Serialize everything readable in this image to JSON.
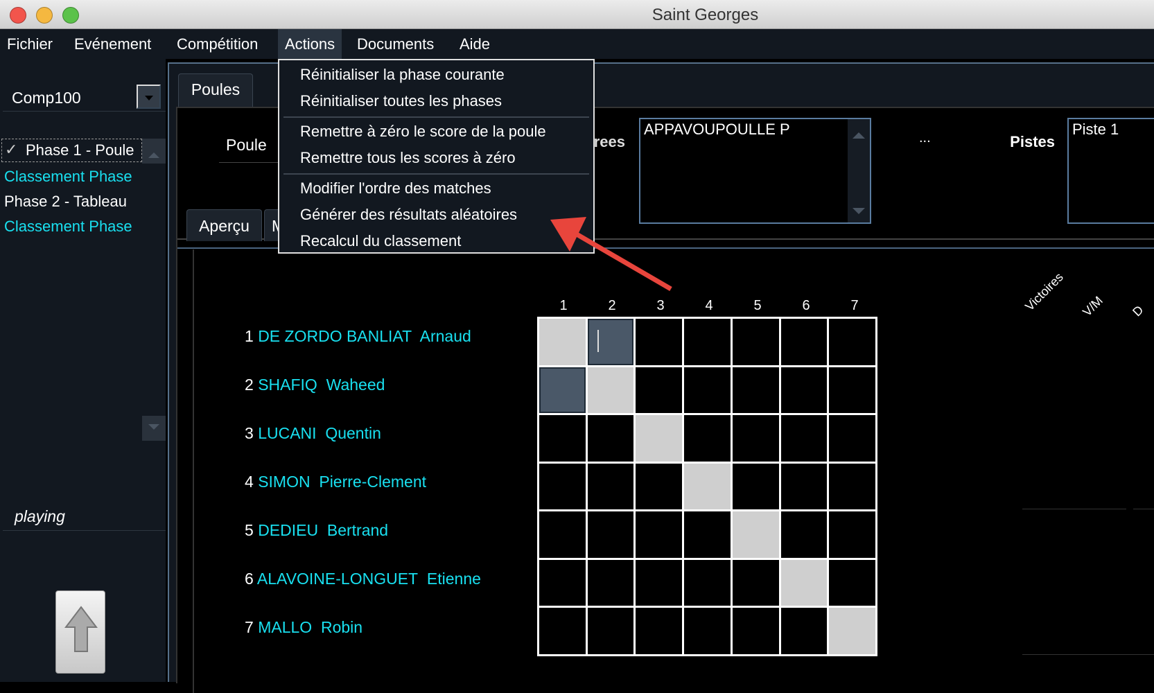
{
  "window": {
    "title": "Saint Georges"
  },
  "menubar": [
    "Fichier",
    "Evénement",
    "Compétition",
    "Actions",
    "Documents",
    "Aide"
  ],
  "sidebar": {
    "competition": "Comp100",
    "phases": [
      {
        "label": "Phase 1 - Poule",
        "checked": true,
        "color": "white"
      },
      {
        "label": "Classement Phase",
        "color": "cyan"
      },
      {
        "label": "Phase 2 - Tableau",
        "color": "white"
      },
      {
        "label": "Classement Phase",
        "color": "cyan"
      }
    ],
    "status": "playing"
  },
  "tabs": {
    "main": "Poules",
    "sub": [
      "Aperçu",
      "M"
    ]
  },
  "poule_label": "Poule",
  "referees": {
    "label": "Referees",
    "items": [
      "APPAVOUPOULLE P"
    ],
    "more": "..."
  },
  "pistes": {
    "label": "Pistes",
    "items": [
      "Piste 1"
    ]
  },
  "actions_menu": {
    "groups": [
      [
        "Réinitialiser la phase courante",
        "Réinitialiser toutes les phases"
      ],
      [
        "Remettre à zéro le score de la poule",
        "Remettre tous les scores à zéro"
      ],
      [
        "Modifier l'ordre des matches",
        "Générer des résultats aléatoires",
        "Recalcul du classement"
      ]
    ],
    "highlighted": "Générer des résultats aléatoires"
  },
  "annotation": {
    "arrow_color": "#e8453c"
  },
  "pool": {
    "columns": [
      "1",
      "2",
      "3",
      "4",
      "5",
      "6",
      "7"
    ],
    "fencers": [
      {
        "n": "1",
        "name": "DE ZORDO BANLIAT",
        "first": "Arnaud"
      },
      {
        "n": "2",
        "name": "SHAFIQ",
        "first": "Waheed"
      },
      {
        "n": "3",
        "name": "LUCANI",
        "first": "Quentin"
      },
      {
        "n": "4",
        "name": "SIMON",
        "first": "Pierre-Clement"
      },
      {
        "n": "5",
        "name": "DEDIEU",
        "first": "Bertrand"
      },
      {
        "n": "6",
        "name": "ALAVOINE-LONGUET",
        "first": "Etienne"
      },
      {
        "n": "7",
        "name": "MALLO",
        "first": "Robin"
      }
    ],
    "stat_headers": [
      "Victoires",
      "V/M",
      "D"
    ]
  },
  "colors": {
    "accent": "#19e0f0",
    "background": "#121820"
  }
}
